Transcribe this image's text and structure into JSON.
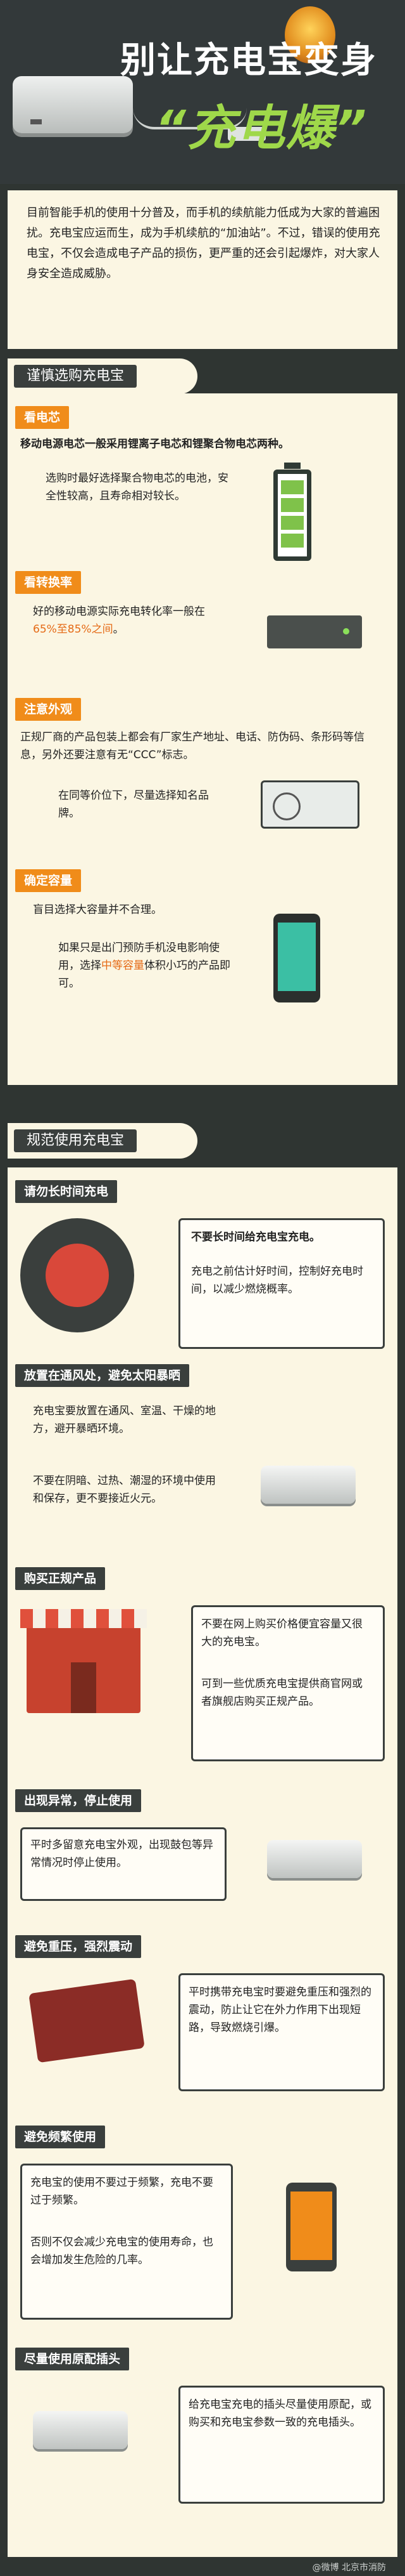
{
  "header": {
    "title_line1": "别让充电宝变身",
    "title_line2": "“充电爆”"
  },
  "intro": {
    "text": "目前智能手机的使用十分普及，而手机的续航能力低成为大家的普遍困扰。充电宝应运而生，成为手机续航的“加油站”。不过，错误的使用充电宝，不仅会造成电子产品的损伤，更严重的还会引起爆炸，对大家人身安全造成威胁。"
  },
  "section1": {
    "label": "谨慎选购充电宝",
    "cell": {
      "tag": "看电芯",
      "text1": "移动电源电芯一般采用锂离子电芯和锂聚合物电芯两种。",
      "text2": "选购时最好选择聚合物电芯的电池，安全性较高，且寿命相对较长。"
    },
    "efficiency": {
      "tag": "看转换率",
      "text_before": "好的移动电源实际充电转化率一般在",
      "highlight": "65%至85%之间",
      "text_after": "。"
    },
    "appearance": {
      "tag": "注意外观",
      "text": "正规厂商的产品包装上都会有厂家生产地址、电话、防伪码、条形码等信息，另外还要注意有无“CCC”标志。",
      "text2": "在同等价位下，尽量选择知名品牌。"
    },
    "capacity": {
      "tag": "确定容量",
      "text1": "盲目选择大容量并不合理。",
      "text2_before": "如果只是出门预防手机没电影响使用，选择",
      "highlight": "中等容量",
      "text2_after": "体积小巧的产品即可。"
    }
  },
  "section2": {
    "label": "规范使用充电宝",
    "items": [
      {
        "tag": "请勿长时间充电",
        "text1": "不要长时间给充电宝充电。",
        "text2": "充电之前估计好时间，控制好充电时间，以减少燃烧概率。"
      },
      {
        "tag": "放置在通风处，避免太阳暴晒",
        "text1": "充电宝要放置在通风、室温、干燥的地方，避开暴晒环境。",
        "text2": "不要在阴暗、过热、潮湿的环境中使用和保存，更不要接近火元。"
      },
      {
        "tag": "购买正规产品",
        "text1": "不要在网上购买价格便宜容量又很大的充电宝。",
        "text2": "可到一些优质充电宝提供商官网或者旗舰店购买正规产品。"
      },
      {
        "tag": "出现异常，停止使用",
        "text1": "平时多留意充电宝外观，出现鼓包等异常情况时停止使用。"
      },
      {
        "tag": "避免重压，强烈震动",
        "text1": "平时携带充电宝时要避免重压和强烈的震动，防止让它在外力作用下出现短路，导致燃烧引爆。"
      },
      {
        "tag": "避免频繁使用",
        "text1": "充电宝的使用不要过于频繁，充电不要过于频繁。",
        "text2": "否则不仅会减少充电宝的使用寿命，也会增加发生危险的几率。"
      },
      {
        "tag": "尽量使用原配插头",
        "text1": "给充电宝充电的插头尽量使用原配，或购买和充电宝参数一致的充电插头。"
      }
    ]
  },
  "watermark": "@微博 北京市消防"
}
